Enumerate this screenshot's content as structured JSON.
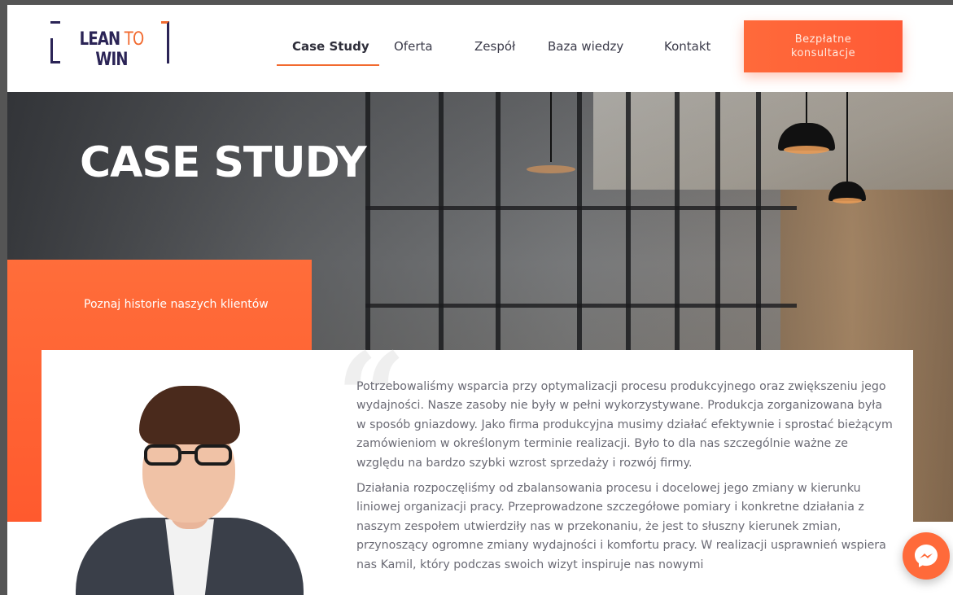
{
  "header": {
    "logo": {
      "part1": "LEAN",
      "part2": "TO",
      "part3": "WIN"
    },
    "nav": [
      {
        "label": "Case Study",
        "active": true
      },
      {
        "label": "Oferta",
        "active": false
      },
      {
        "label": "Zespół",
        "active": false
      },
      {
        "label": "Baza wiedzy",
        "active": false
      },
      {
        "label": "Kontakt",
        "active": false
      }
    ],
    "cta_label": "Bezpłatne konsultacje"
  },
  "hero": {
    "title": "CASE STUDY",
    "subtitle": "Poznaj historie naszych klientów"
  },
  "testimonial": {
    "paragraphs": [
      "Potrzebowaliśmy wsparcia przy optymalizacji procesu produkcyjnego oraz zwiększeniu jego wydajności. Nasze zasoby nie były w pełni wykorzystywane. Produkcja zorganizowana była w sposób gniazdowy. Jako firma produkcyjna musimy działać efektywnie i sprostać bieżącym zamówieniom w określonym terminie realizacji. Było to dla nas szczególnie ważne ze względu na bardzo szybki wzrost sprzedaży i rozwój firmy.",
      "Działania rozpoczęliśmy od zbalansowania procesu i docelowej jego zmiany w kierunku liniowej organizacji pracy. Przeprowadzone szczegółowe pomiary i konkretne działania z naszym zespołem utwierdziły nas w przekonaniu, że jest to słuszny kierunek zmian, przynoszący ogromne zmiany wydajności i komfortu pracy. W realizacji usprawnień wspiera nas Kamil, który podczas swoich wizyt inspiruje nas nowymi"
    ]
  },
  "colors": {
    "accent": "#ff6a3a",
    "brand_navy": "#2b2456",
    "text_gray": "#6b6b75"
  },
  "icons": {
    "messenger": "messenger-icon"
  }
}
